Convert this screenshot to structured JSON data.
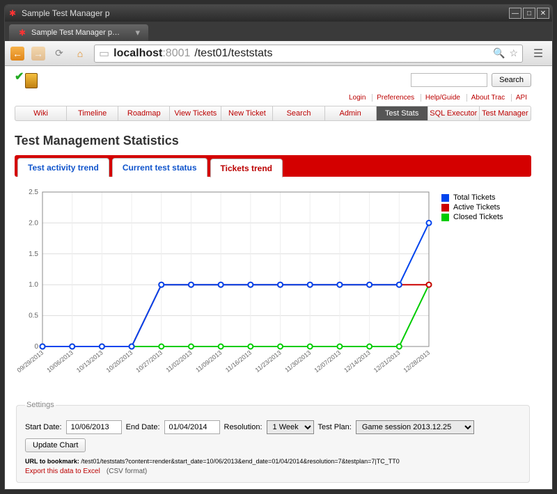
{
  "window": {
    "title": "Sample Test Manager p"
  },
  "browser": {
    "tab_title": "Sample Test Manager p…",
    "url_host_prefix": "localhost",
    "url_host_port": ":8001",
    "url_path": "/test01/teststats"
  },
  "search": {
    "button": "Search",
    "placeholder": ""
  },
  "metanav": {
    "login": "Login",
    "prefs": "Preferences",
    "help": "Help/Guide",
    "about": "About Trac",
    "api": "API"
  },
  "mainnav": {
    "wiki": "Wiki",
    "timeline": "Timeline",
    "roadmap": "Roadmap",
    "view_tickets": "View Tickets",
    "new_ticket": "New Ticket",
    "search": "Search",
    "admin": "Admin",
    "test_stats": "Test Stats",
    "sql_exec": "SQL Executor",
    "test_manager": "Test Manager"
  },
  "page_title": "Test Management Statistics",
  "tabs": {
    "activity": "Test activity trend",
    "status": "Current test status",
    "tickets": "Tickets trend"
  },
  "legend": {
    "total": "Total Tickets",
    "active": "Active Tickets",
    "closed": "Closed Tickets"
  },
  "chart_data": {
    "type": "line",
    "categories": [
      "09/29/2013",
      "10/06/2013",
      "10/13/2013",
      "10/20/2013",
      "10/27/2013",
      "11/02/2013",
      "11/09/2013",
      "11/16/2013",
      "11/23/2013",
      "11/30/2013",
      "12/07/2013",
      "12/14/2013",
      "12/21/2013",
      "12/28/2013"
    ],
    "series": [
      {
        "name": "Total Tickets",
        "color": "#0044ee",
        "values": [
          0,
          0,
          0,
          0,
          1,
          1,
          1,
          1,
          1,
          1,
          1,
          1,
          1,
          2
        ]
      },
      {
        "name": "Active Tickets",
        "color": "#cc0000",
        "values": [
          0,
          0,
          0,
          0,
          1,
          1,
          1,
          1,
          1,
          1,
          1,
          1,
          1,
          1
        ]
      },
      {
        "name": "Closed Tickets",
        "color": "#00cc00",
        "values": [
          0,
          0,
          0,
          0,
          0,
          0,
          0,
          0,
          0,
          0,
          0,
          0,
          0,
          1
        ]
      }
    ],
    "ylim": [
      0,
      2.5
    ],
    "yticks": [
      0,
      0.5,
      1.0,
      1.5,
      2.0,
      2.5
    ],
    "xlabel": "",
    "ylabel": "",
    "title": ""
  },
  "settings": {
    "legend": "Settings",
    "start_label": "Start Date:",
    "start_value": "10/06/2013",
    "end_label": "End Date:",
    "end_value": "01/04/2014",
    "res_label": "Resolution:",
    "res_value": "1 Week",
    "plan_label": "Test Plan:",
    "plan_value": "Game session 2013.12.25",
    "update_btn": "Update Chart",
    "bookmark_label": "URL to bookmark:",
    "bookmark_value": "/test01/teststats?content=render&start_date=10/06/2013&end_date=01/04/2014&resolution=7&testplan=7|TC_TT0",
    "export": "Export this data to Excel",
    "csv": "(CSV format)"
  }
}
